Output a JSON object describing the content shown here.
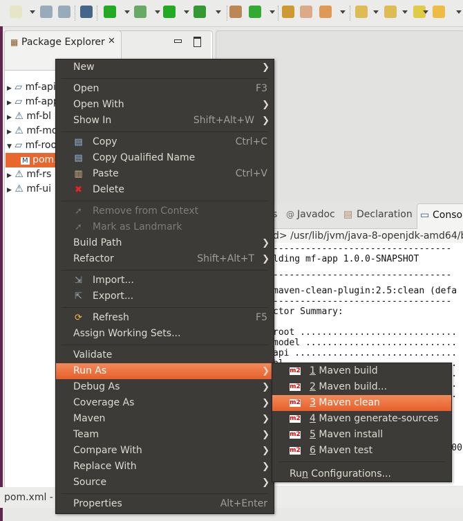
{
  "toolbar": {
    "icons": [
      "new-wizard-icon",
      "save-icon",
      "save-all-icon",
      "toggle-mark-occurrences-icon",
      "run-last-icon",
      "debug-icon",
      "run-icon",
      "external-tools-icon",
      "new-java-package-icon",
      "new-class-icon",
      "open-type-icon",
      "open-task-icon",
      "search-icon",
      "next-annotation-icon",
      "previous-annotation-icon",
      "last-edit-location-icon",
      "back-icon"
    ]
  },
  "package_explorer": {
    "title": "Package Explorer",
    "tree": [
      {
        "label": "mf-api",
        "expanded": false,
        "warning": false
      },
      {
        "label": "mf-app",
        "expanded": false,
        "warning": false
      },
      {
        "label": "mf-bl",
        "expanded": false,
        "warning": true
      },
      {
        "label": "mf-mo",
        "expanded": false,
        "warning": true
      },
      {
        "label": "mf-roo",
        "expanded": true,
        "warning": false
      },
      {
        "label": "pom.",
        "child": true,
        "selected": true
      },
      {
        "label": "mf-rs",
        "expanded": false,
        "warning": true
      },
      {
        "label": "mf-ui",
        "expanded": false,
        "warning": true
      }
    ]
  },
  "console": {
    "tabs": [
      "s",
      "Javadoc",
      "Declaration",
      "Consol"
    ],
    "header": "d> /usr/lib/jvm/java-8-openjdk-amd64/bin",
    "lines": [
      "---------------------------------",
      "lding mf-app 1.0.0-SNAPSHOT",
      "---------------------------------",
      "",
      "maven-clean-plugin:2.5:clean (defa",
      "---------------------------------",
      "ctor Summary:",
      "",
      "root .............................",
      "model ............................",
      "api ..............................",
      "bl ...............................",
      ". ................................",
      ". ................................",
      ". ................................",
      "---------------------------------",
      "",
      "---------------------------------",
      "",
      "                                :00",
      "",
      "---------------------------------"
    ]
  },
  "status": {
    "text": "pom.xml - r"
  },
  "context_menu": {
    "items": [
      {
        "label": "New",
        "submenu": true
      },
      {
        "sep": true
      },
      {
        "label": "Open",
        "shortcut": "F3"
      },
      {
        "label": "Open With",
        "submenu": true
      },
      {
        "label": "Show In",
        "shortcut": "Shift+Alt+W",
        "submenu": true
      },
      {
        "sep": true
      },
      {
        "label": "Copy",
        "shortcut": "Ctrl+C",
        "icon": "copy-icon"
      },
      {
        "label": "Copy Qualified Name",
        "icon": "copy-qualified-name-icon"
      },
      {
        "label": "Paste",
        "shortcut": "Ctrl+V",
        "icon": "paste-icon"
      },
      {
        "label": "Delete",
        "icon": "delete-icon"
      },
      {
        "sep": true
      },
      {
        "label": "Remove from Context",
        "icon": "remove-context-icon",
        "disabled": true
      },
      {
        "label": "Mark as Landmark",
        "icon": "landmark-icon",
        "disabled": true
      },
      {
        "label": "Build Path",
        "submenu": true
      },
      {
        "label": "Refactor",
        "shortcut": "Shift+Alt+T",
        "submenu": true
      },
      {
        "sep": true
      },
      {
        "label": "Import...",
        "icon": "import-icon"
      },
      {
        "label": "Export...",
        "icon": "export-icon"
      },
      {
        "sep": true
      },
      {
        "label": "Refresh",
        "shortcut": "F5",
        "icon": "refresh-icon"
      },
      {
        "label": "Assign Working Sets..."
      },
      {
        "sep": true
      },
      {
        "label": "Validate"
      },
      {
        "label": "Run As",
        "submenu": true,
        "highlighted": true
      },
      {
        "label": "Debug As",
        "submenu": true
      },
      {
        "label": "Coverage As",
        "submenu": true
      },
      {
        "label": "Maven",
        "submenu": true
      },
      {
        "label": "Team",
        "submenu": true
      },
      {
        "label": "Compare With",
        "submenu": true
      },
      {
        "label": "Replace With",
        "submenu": true
      },
      {
        "label": "Source",
        "submenu": true
      },
      {
        "sep": true
      },
      {
        "label": "Properties",
        "shortcut": "Alt+Enter"
      }
    ]
  },
  "run_as_submenu": {
    "items": [
      {
        "num": "1",
        "label": " Maven build"
      },
      {
        "num": "2",
        "label": " Maven build..."
      },
      {
        "num": "3",
        "label": " Maven clean",
        "highlighted": true
      },
      {
        "num": "4",
        "label": " Maven generate-sources"
      },
      {
        "num": "5",
        "label": " Maven install"
      },
      {
        "num": "6",
        "label": " Maven test"
      }
    ],
    "run_configurations": {
      "pre": "Ru",
      "mnemonic": "n",
      "post": " Configurations..."
    },
    "icon_text": "m2"
  },
  "colors": {
    "highlight": "#e95f2b",
    "menu_bg": "#3c3b37"
  }
}
